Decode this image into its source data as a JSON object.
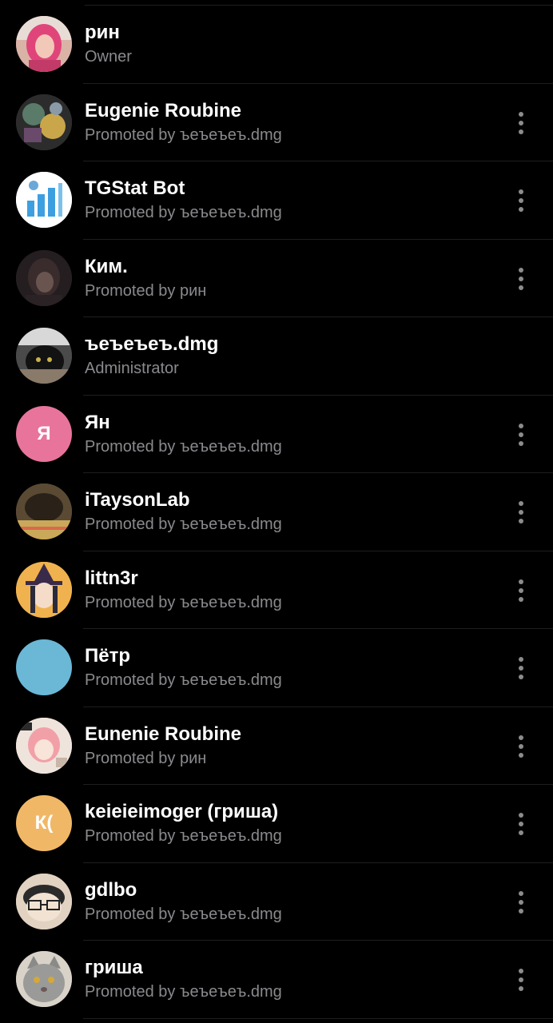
{
  "members": [
    {
      "name": "рин",
      "role": "Owner",
      "avatar": {
        "type": "photo",
        "icon": "user-photo-pink-hair",
        "bg": "#c98a7a"
      },
      "has_menu": false
    },
    {
      "name": "Eugenie Roubine",
      "role": "Promoted by ъеъеъеъ.dmg",
      "avatar": {
        "type": "photo",
        "icon": "user-photo-abstract",
        "bg": "#3a3a3a"
      },
      "has_menu": true
    },
    {
      "name": "TGStat Bot",
      "role": "Promoted by ъеъеъеъ.dmg",
      "avatar": {
        "type": "photo",
        "icon": "tgstat-logo",
        "bg": "#ffffff"
      },
      "has_menu": true
    },
    {
      "name": "Ким.",
      "role": "Promoted by рин",
      "avatar": {
        "type": "photo",
        "icon": "user-photo-anime-dark",
        "bg": "#2a2426"
      },
      "has_menu": true
    },
    {
      "name": "ъеъеъеъ.dmg",
      "role": "Administrator",
      "avatar": {
        "type": "photo",
        "icon": "user-photo-cat",
        "bg": "#3c3a38"
      },
      "has_menu": false
    },
    {
      "name": "Ян",
      "role": "Promoted by ъеъеъеъ.dmg",
      "avatar": {
        "type": "initials",
        "text": "Я",
        "bg": "#e8749b"
      },
      "has_menu": true
    },
    {
      "name": "iTaysonLab",
      "role": "Promoted by ъеъеъеъ.dmg",
      "avatar": {
        "type": "photo",
        "icon": "user-photo-cat-blanket",
        "bg": "#6b5a3a"
      },
      "has_menu": true
    },
    {
      "name": "littn3r",
      "role": "Promoted by ъеъеъеъ.dmg",
      "avatar": {
        "type": "photo",
        "icon": "user-photo-anime-witch",
        "bg": "#e8a94a"
      },
      "has_menu": true
    },
    {
      "name": "Пётр",
      "role": "Promoted by ъеъеъеъ.dmg",
      "avatar": {
        "type": "color",
        "text": "",
        "bg": "#6ab8d6"
      },
      "has_menu": true
    },
    {
      "name": "Eunenie Roubine",
      "role": "Promoted by рин",
      "avatar": {
        "type": "photo",
        "icon": "user-photo-anime-pink",
        "bg": "#e6d2c6"
      },
      "has_menu": true
    },
    {
      "name": "keieieimoger (гриша)",
      "role": "Promoted by ъеъеъеъ.dmg",
      "avatar": {
        "type": "initials",
        "text": "К(",
        "bg": "#f0b866"
      },
      "has_menu": true
    },
    {
      "name": "gdlbo",
      "role": "Promoted by ъеъеъеъ.dmg",
      "avatar": {
        "type": "photo",
        "icon": "user-photo-glasses-drawing",
        "bg": "#d9c4b0"
      },
      "has_menu": true
    },
    {
      "name": "гриша",
      "role": "Promoted by ъеъеъеъ.dmg",
      "avatar": {
        "type": "photo",
        "icon": "user-photo-grey-cat",
        "bg": "#8a8a86"
      },
      "has_menu": true
    }
  ],
  "colors": {
    "background": "#000000",
    "name": "#ffffff",
    "role": "#8a8a8e",
    "divider": "#1e1e1e",
    "menu_dots": "#8c8c8c"
  }
}
